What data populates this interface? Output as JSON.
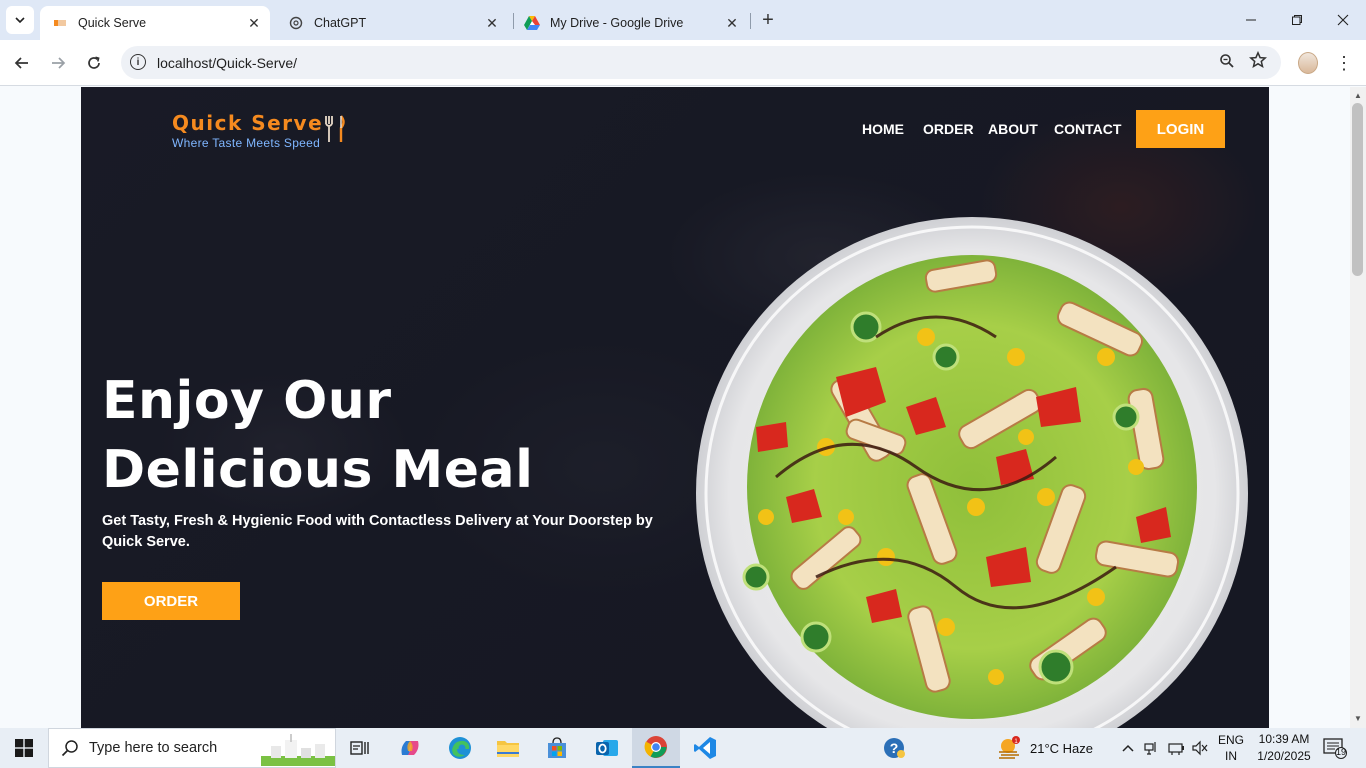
{
  "browser": {
    "tabs": [
      {
        "title": "Quick Serve",
        "active": true
      },
      {
        "title": "ChatGPT",
        "active": false
      },
      {
        "title": "My Drive - Google Drive",
        "active": false
      }
    ],
    "url": "localhost/Quick-Serve/"
  },
  "site": {
    "logo_name": "Quick Serve",
    "logo_tagline": "Where Taste Meets Speed",
    "nav": [
      "HOME",
      "ORDER",
      "ABOUT",
      "CONTACT"
    ],
    "login_label": "LOGIN",
    "headline_line1": "Enjoy Our",
    "headline_line2": "Delicious Meal",
    "subheadline": "Get Tasty, Fresh & Hygienic Food with Contactless Delivery at Your Doorstep by Quick Serve.",
    "order_label": "ORDER",
    "colors": {
      "accent": "#fea116",
      "logo_orange": "#f58a1f",
      "logo_blue": "#7fb6ff"
    }
  },
  "taskbar": {
    "search_placeholder": "Type here to search",
    "weather": "21°C  Haze",
    "language_line1": "ENG",
    "language_line2": "IN",
    "time": "10:39 AM",
    "date": "1/20/2025",
    "notification_count": "19"
  }
}
